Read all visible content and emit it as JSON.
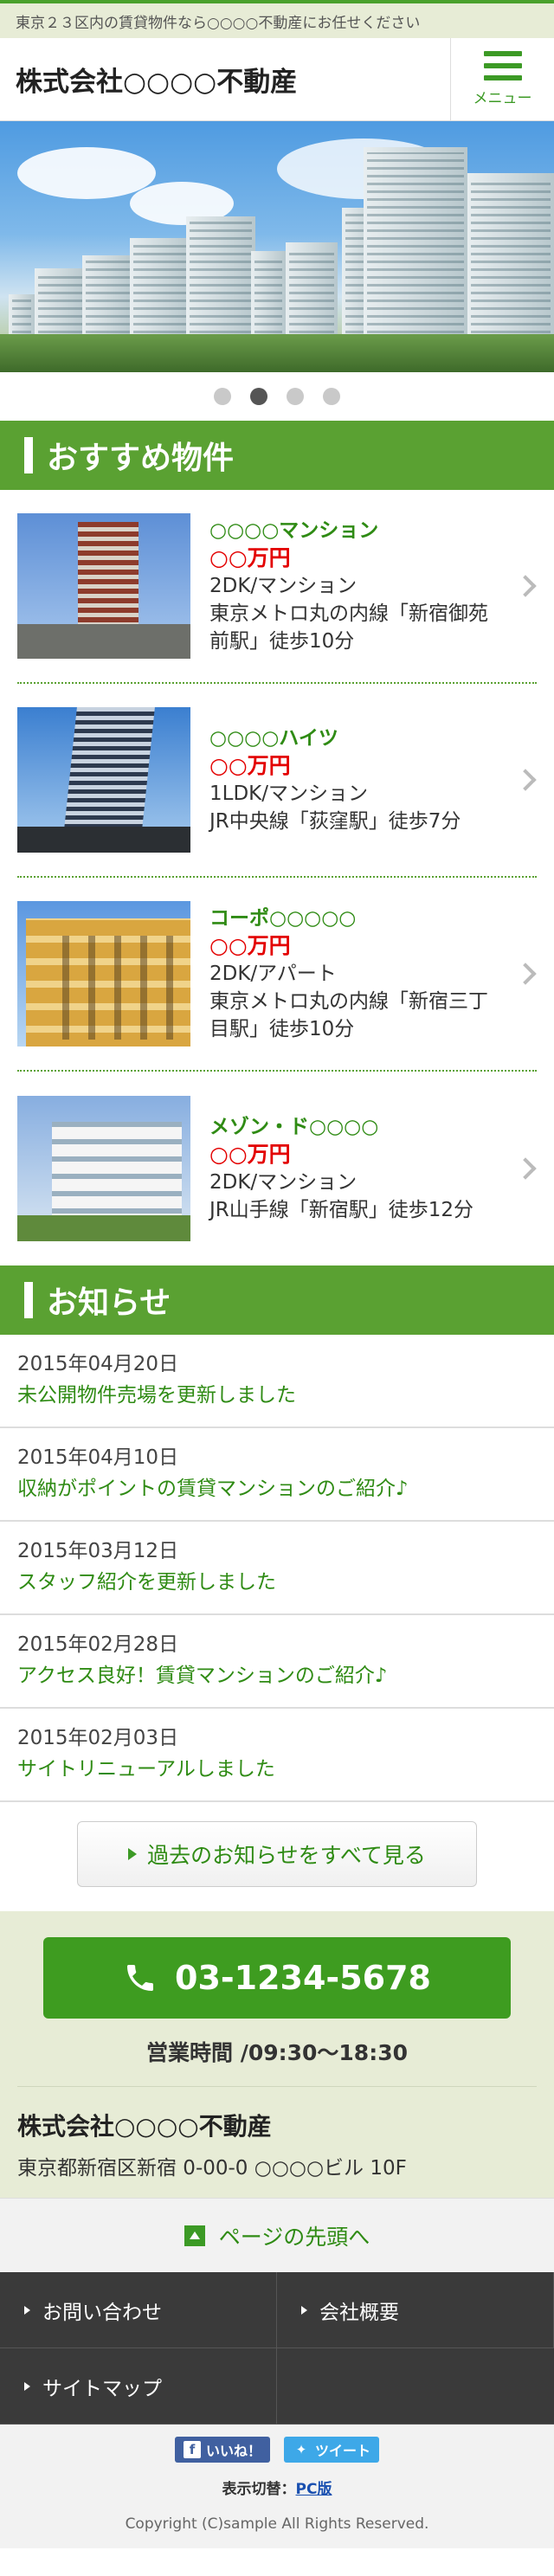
{
  "topbar": {
    "text": "東京２３区内の賃貸物件なら○○○○不動産にお任せください"
  },
  "header": {
    "logo": "株式会社○○○○不動産",
    "menu_label": "メニュー"
  },
  "slider": {
    "total": 4,
    "active_index": 1
  },
  "recommend": {
    "title": "おすすめ物件",
    "items": [
      {
        "name": "○○○○マンション",
        "price": "○○万円",
        "type": "2DK/マンション",
        "access": "東京メトロ丸の内線「新宿御苑前駅」徒歩10分",
        "photo": "tower-blue"
      },
      {
        "name": "○○○○ハイツ",
        "price": "○○万円",
        "type": "1LDK/マンション",
        "access": "JR中央線「荻窪駅」徒歩7分",
        "photo": "tower-sky"
      },
      {
        "name": "コーポ○○○○○",
        "price": "○○万円",
        "type": "2DK/アパート",
        "access": "東京メトロ丸の内線「新宿三丁目駅」徒歩10分",
        "photo": "yellow-building"
      },
      {
        "name": "メゾン・ド○○○○",
        "price": "○○万円",
        "type": "2DK/マンション",
        "access": "JR山手線「新宿駅」徒歩12分",
        "photo": "white-building"
      }
    ]
  },
  "news": {
    "title": "お知らせ",
    "items": [
      {
        "date": "2015年04月20日",
        "title": "未公開物件売場を更新しました"
      },
      {
        "date": "2015年04月10日",
        "title": "収納がポイントの賃貸マンションのご紹介♪"
      },
      {
        "date": "2015年03月12日",
        "title": "スタッフ紹介を更新しました"
      },
      {
        "date": "2015年02月28日",
        "title": "アクセス良好！賃貸マンションのご紹介♪"
      },
      {
        "date": "2015年02月03日",
        "title": "サイトリニューアルしました"
      }
    ],
    "more_label": "過去のお知らせをすべて見る"
  },
  "contact": {
    "phone": "03-1234-5678",
    "hours": "営業時間 /09:30〜18:30",
    "company": "株式会社○○○○不動産",
    "address": "東京都新宿区新宿 0-00-0 ○○○○ビル 10F"
  },
  "pagetop": {
    "label": "ページの先頭へ"
  },
  "footer_nav": [
    {
      "label": "お問い合わせ"
    },
    {
      "label": "会社概要"
    },
    {
      "label": "サイトマップ"
    }
  ],
  "social": {
    "facebook_label": "いいね！",
    "twitter_label": "ツイート"
  },
  "view_switch": {
    "label": "表示切替：",
    "link": "PC版"
  },
  "copyright": "Copyright (C)sample All Rights Reserved.",
  "colors": {
    "brand_green": "#5aa132",
    "link_green": "#2f8b14",
    "price_red": "#e30000"
  }
}
